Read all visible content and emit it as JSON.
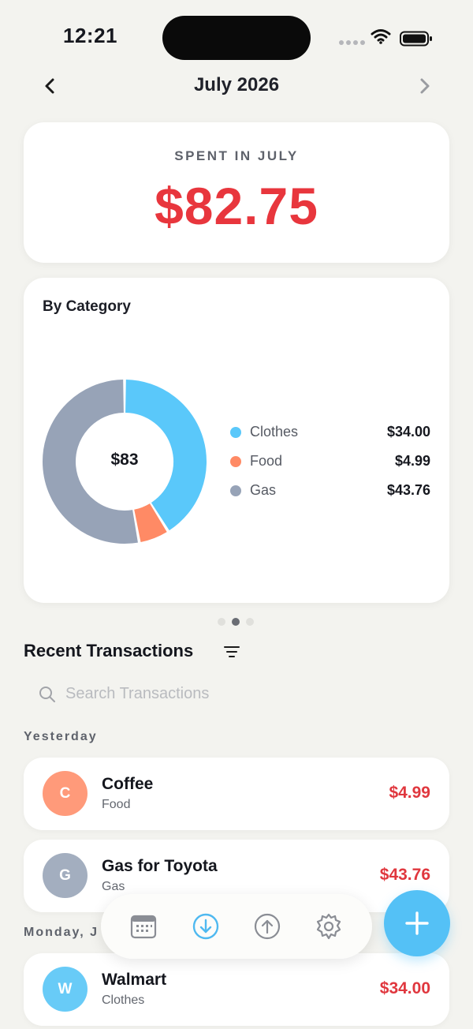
{
  "status": {
    "time": "12:21"
  },
  "header": {
    "title": "July 2026"
  },
  "summary": {
    "label": "SPENT IN JULY",
    "amount": "$82.75"
  },
  "category_card": {
    "title": "By Category",
    "center_total": "$83",
    "items": [
      {
        "name": "Clothes",
        "amount": "$34.00",
        "value": 34.0,
        "color": "#5AC8FA"
      },
      {
        "name": "Food",
        "amount": "$4.99",
        "value": 4.99,
        "color": "#FF8A65"
      },
      {
        "name": "Gas",
        "amount": "$43.76",
        "value": 43.76,
        "color": "#97A3B7"
      }
    ]
  },
  "pager": {
    "count": 3,
    "active": 1
  },
  "transactions": {
    "title": "Recent Transactions",
    "search_placeholder": "Search Transactions",
    "groups": [
      {
        "label": "Yesterday",
        "items": [
          {
            "initial": "C",
            "name": "Coffee",
            "category": "Food",
            "amount": "$4.99",
            "color": "#FF9A7A"
          },
          {
            "initial": "G",
            "name": "Gas for Toyota",
            "category": "Gas",
            "amount": "$43.76",
            "color": "#A3AEBF"
          }
        ]
      },
      {
        "label": "Monday, J",
        "items": [
          {
            "initial": "W",
            "name": "Walmart",
            "category": "Clothes",
            "amount": "$34.00",
            "color": "#68CBF7"
          }
        ]
      }
    ]
  },
  "tabbar": {
    "tabs": [
      {
        "icon": "calendar-icon",
        "active": false
      },
      {
        "icon": "download-icon",
        "active": true
      },
      {
        "icon": "upload-icon",
        "active": false
      },
      {
        "icon": "gear-icon",
        "active": false
      }
    ],
    "accent": "#4FB9F0",
    "inactive": "#8A8D94"
  },
  "fab": {
    "icon": "plus-icon",
    "color": "#54C1F6"
  }
}
